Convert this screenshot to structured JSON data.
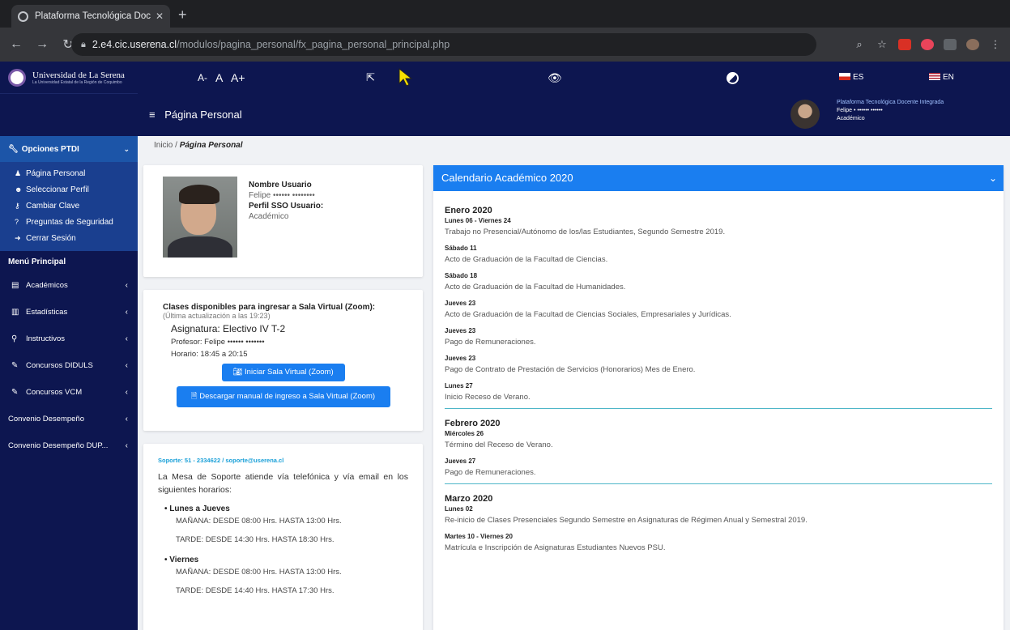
{
  "browser": {
    "tab_title": "Plataforma Tecnológica Docen",
    "url_host": "2.e4.cic.userena.cl",
    "url_path": "/modulos/pagina_personal/fx_pagina_personal_principal.php"
  },
  "sidebar": {
    "brand_name": "Universidad de La Serena",
    "brand_sub": "La Universidad Estatal de la Región de Coquimbo",
    "options_title": "Opciones PTDI",
    "options": [
      "Página Personal",
      "Seleccionar Perfil",
      "Cambiar Clave",
      "Preguntas de Seguridad",
      "Cerrar Sesión"
    ],
    "menu_title": "Menú Principal",
    "menu": [
      "Académicos",
      "Estadísticas",
      "Instructivos",
      "Concursos DIDULS",
      "Concursos VCM",
      "Convenio Desempeño",
      "Convenio Desempeño DUP..."
    ]
  },
  "header": {
    "font_small": "A-",
    "font_normal": "A",
    "font_large": "A+",
    "lang_es": "ES",
    "lang_en": "EN",
    "page_title": "Página Personal",
    "platform_name": "Plataforma Tecnológica Docente Integrada",
    "user_name": "Felipe • •••••• ••••••",
    "user_role": "Académico"
  },
  "breadcrumb": {
    "home": "Inicio",
    "separator": "/",
    "current": "Página Personal"
  },
  "profile": {
    "label_user": "Nombre Usuario",
    "user_value": "Felipe •••••• ••••••••",
    "label_sso": "Perfil SSO Usuario:",
    "sso_value": "Académico"
  },
  "zoom": {
    "title": "Clases disponibles para ingresar a Sala Virtual (Zoom):",
    "updated": "(Última actualización a las 19:23)",
    "subject": "Asignatura: Electivo IV T-2",
    "professor": "Profesor: Felipe •••••• •••••••",
    "schedule": "Horario: 18:45 a 20:15",
    "start_button": "Iniciar Sala Virtual (Zoom)",
    "manual_button": "Descargar manual de ingreso a Sala Virtual (Zoom)"
  },
  "support": {
    "header": "Soporte: 51 - 2334622 / soporte@userena.cl",
    "text": "La Mesa de Soporte atiende vía telefónica y vía email en los siguientes horarios:",
    "schedule": [
      {
        "day": "Lunes a Jueves",
        "morning": "MAÑANA: DESDE 08:00 Hrs. HASTA 13:00 Hrs.",
        "afternoon": "TARDE: DESDE 14:30 Hrs. HASTA 18:30 Hrs."
      },
      {
        "day": "Viernes",
        "morning": "MAÑANA: DESDE 08:00 Hrs. HASTA 13:00 Hrs.",
        "afternoon": "TARDE: DESDE 14:40 Hrs. HASTA 17:30 Hrs."
      }
    ]
  },
  "calendar": {
    "title": "Calendario Académico 2020",
    "months": [
      {
        "name": "Enero 2020",
        "events": [
          {
            "date": "Lunes 06 - Viernes 24",
            "desc": "Trabajo no Presencial/Autónomo de los/las Estudiantes, Segundo Semestre 2019."
          },
          {
            "date": "Sábado 11",
            "desc": "Acto de Graduación de la Facultad de Ciencias."
          },
          {
            "date": "Sábado 18",
            "desc": "Acto de Graduación de la Facultad de Humanidades."
          },
          {
            "date": "Jueves 23",
            "desc": "Acto de Graduación de la Facultad de Ciencias Sociales, Empresariales y Jurídicas."
          },
          {
            "date": "Jueves 23",
            "desc": "Pago de Remuneraciones."
          },
          {
            "date": "Jueves 23",
            "desc": "Pago de Contrato de Prestación de Servicios (Honorarios) Mes de Enero."
          },
          {
            "date": "Lunes 27",
            "desc": "Inicio Receso de Verano."
          }
        ]
      },
      {
        "name": "Febrero 2020",
        "events": [
          {
            "date": "Miércoles 26",
            "desc": "Término del Receso de Verano."
          },
          {
            "date": "Jueves 27",
            "desc": "Pago de Remuneraciones."
          }
        ]
      },
      {
        "name": "Marzo 2020",
        "events": [
          {
            "date": "Lunes 02",
            "desc": "Re-inicio de Clases Presenciales Segundo Semestre en Asignaturas de Régimen Anual y Semestral 2019."
          },
          {
            "date": "Martes 10 - Viernes 20",
            "desc": "Matrícula e Inscripción de Asignaturas Estudiantes Nuevos PSU."
          }
        ]
      }
    ]
  },
  "colors": {
    "navy": "#0d1650",
    "accent_blue": "#1a7ef0",
    "sidebar_active": "#1c55a8",
    "support_link": "#1aa0d8"
  }
}
